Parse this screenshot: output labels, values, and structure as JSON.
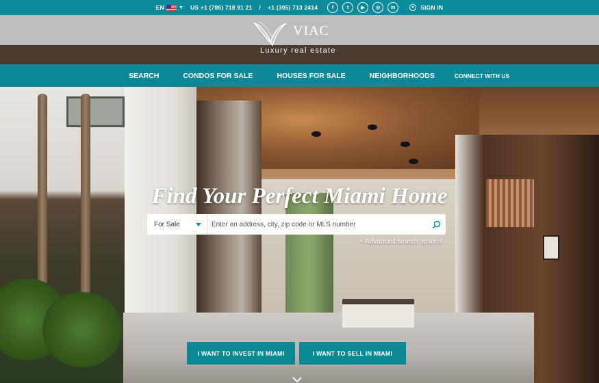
{
  "topbar": {
    "lang": "EN",
    "phone_us": "US +1 (786) 718 91 21",
    "separator": "/",
    "phone_alt": "+1 (305) 713 2414",
    "social": [
      "f",
      "t",
      "yt",
      "ig",
      "in"
    ],
    "signin": "SIGN IN",
    "bg_color": "#0d8a9c"
  },
  "logo": {
    "brand": "VIAC",
    "tagline": "Luxury real estate"
  },
  "nav": {
    "items": [
      "SEARCH",
      "CONDOS FOR SALE",
      "HOUSES FOR SALE",
      "NEIGHBORHOODS",
      "CONNECT WITH US"
    ]
  },
  "hero": {
    "title": "Find Your Perfect Miami Home",
    "search": {
      "type_selected": "For Sale",
      "placeholder": "Enter an address, city, zip code or MLS number"
    },
    "advanced_link": "+ Advanced search options",
    "cta_invest": "I WANT TO INVEST IN MIAMI",
    "cta_sell": "I WANT TO SELL IN MIAMI"
  }
}
